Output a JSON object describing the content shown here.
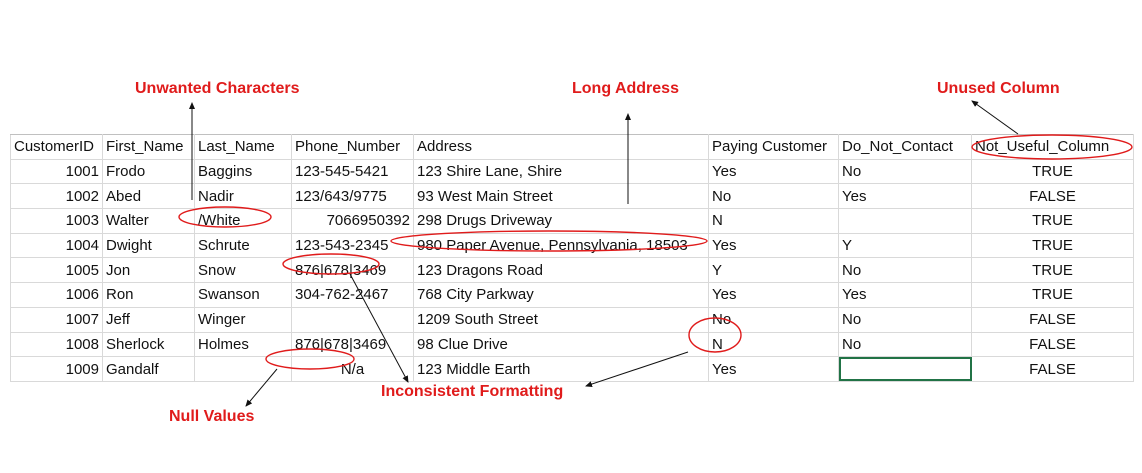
{
  "annotations": {
    "unwanted_characters": "Unwanted Characters",
    "long_address": "Long Address",
    "unused_column": "Unused Column",
    "inconsistent_formatting": "Inconsistent Formatting",
    "null_values": "Null Values"
  },
  "colors": {
    "annotation": "#e01b1b",
    "selected_cell_border": "#217346"
  },
  "table": {
    "headers": [
      "CustomerID",
      "First_Name",
      "Last_Name",
      "Phone_Number",
      "Address",
      "Paying Customer",
      "Do_Not_Contact",
      "Not_Useful_Column"
    ],
    "rows": [
      [
        "1001",
        "Frodo",
        "Baggins",
        "123-545-5421",
        "123 Shire Lane, Shire",
        "Yes",
        "No",
        "TRUE"
      ],
      [
        "1002",
        "Abed",
        "Nadir",
        "123/643/9775",
        "93 West Main Street",
        "No",
        "Yes",
        "FALSE"
      ],
      [
        "1003",
        "Walter",
        "/White",
        "7066950392",
        "298 Drugs Driveway",
        "N",
        "",
        "TRUE"
      ],
      [
        "1004",
        "Dwight",
        "Schrute",
        "123-543-2345",
        "980 Paper Avenue, Pennsylvania, 18503",
        "Yes",
        "Y",
        "TRUE"
      ],
      [
        "1005",
        "Jon",
        "Snow",
        "876|678|3469",
        "123 Dragons Road",
        "Y",
        "No",
        "TRUE"
      ],
      [
        "1006",
        "Ron",
        "Swanson",
        "304-762-2467",
        "768 City Parkway",
        "Yes",
        "Yes",
        "TRUE"
      ],
      [
        "1007",
        "Jeff",
        " Winger",
        "",
        "1209 South Street",
        "No",
        "No",
        "FALSE"
      ],
      [
        "1008",
        "Sherlock",
        "Holmes",
        "876|678|3469",
        "98 Clue Drive",
        "N",
        "No",
        "FALSE"
      ],
      [
        "1009",
        "Gandalf",
        "",
        "N/a",
        "123 Middle Earth",
        "Yes",
        "",
        "FALSE"
      ]
    ]
  }
}
